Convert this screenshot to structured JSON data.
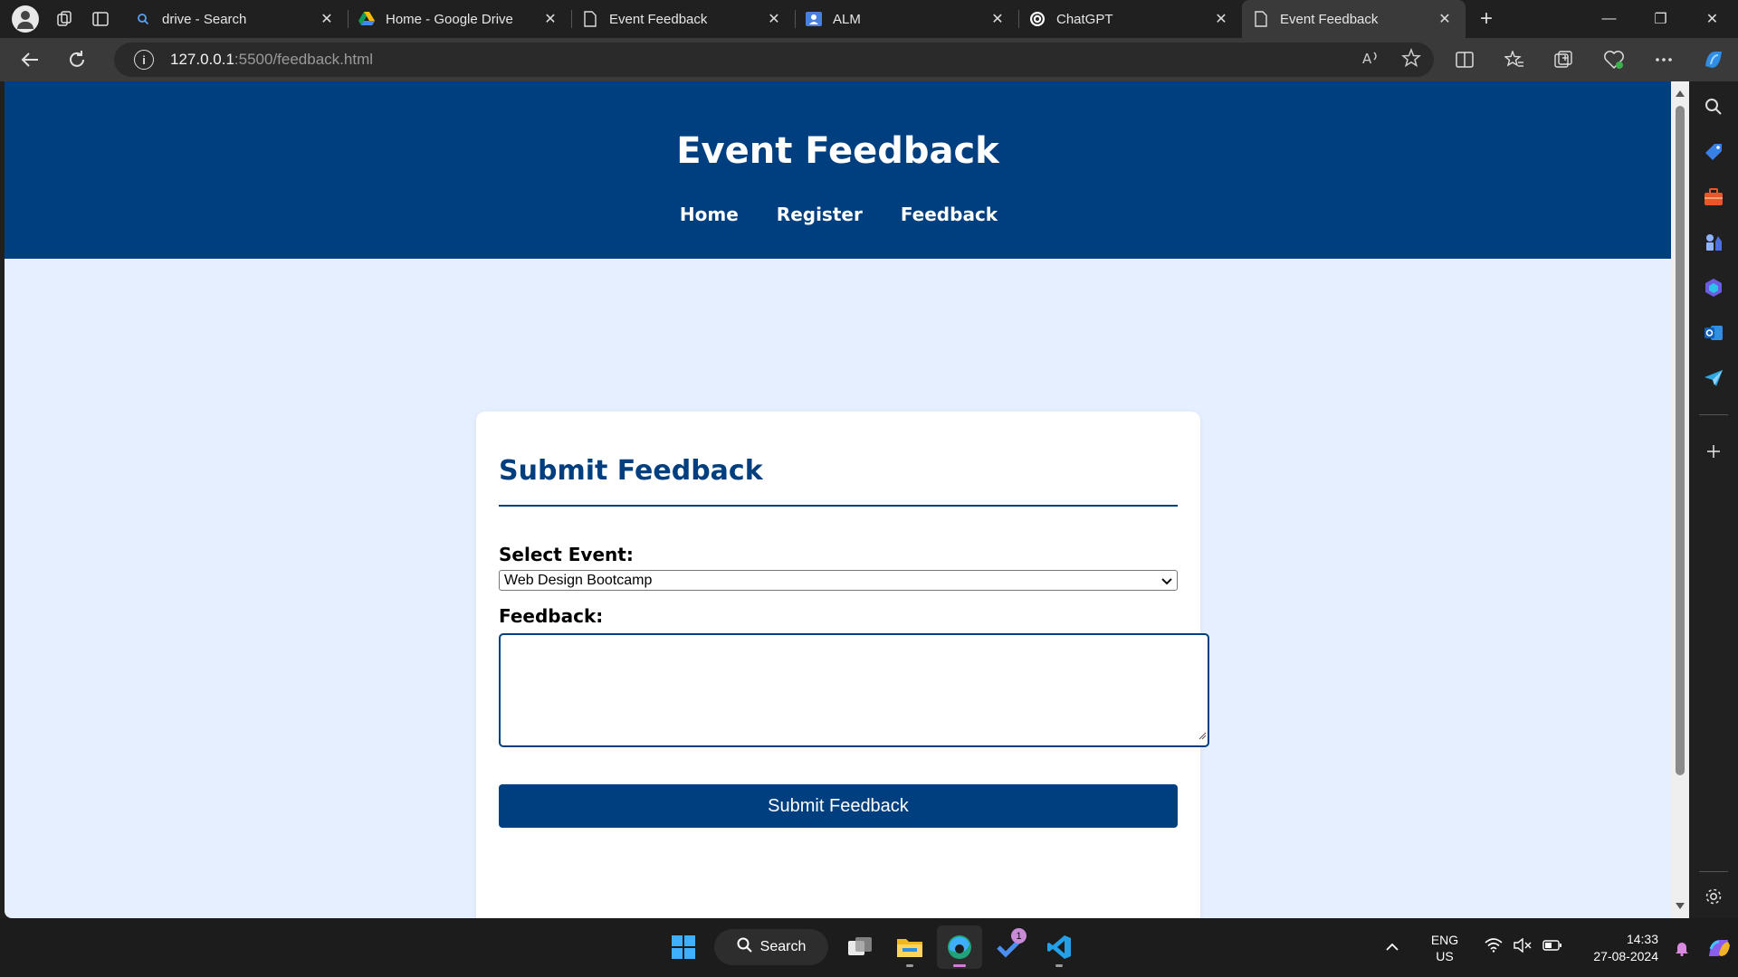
{
  "browser": {
    "tabs": [
      {
        "title": "drive - Search",
        "icon": "search-icon"
      },
      {
        "title": "Home - Google Drive",
        "icon": "google-drive-icon"
      },
      {
        "title": "Event Feedback",
        "icon": "page-icon"
      },
      {
        "title": "ALM",
        "icon": "contacts-icon"
      },
      {
        "title": "ChatGPT",
        "icon": "chatgpt-icon"
      },
      {
        "title": "Event Feedback",
        "icon": "page-icon",
        "active": true
      }
    ],
    "address": {
      "host": "127.0.0.1",
      "path": ":5500/feedback.html"
    }
  },
  "site": {
    "title": "Event Feedback",
    "nav": [
      "Home",
      "Register",
      "Feedback"
    ],
    "card": {
      "heading": "Submit Feedback",
      "select_label": "Select Event:",
      "selected_event": "Web Design Bootcamp",
      "feedback_label": "Feedback:",
      "feedback_value": "",
      "submit_label": "Submit Feedback"
    }
  },
  "taskbar": {
    "search_label": "Search",
    "language": [
      "ENG",
      "US"
    ],
    "time": "14:33",
    "date": "27-08-2024",
    "notification_badge": "1"
  },
  "colors": {
    "header_blue": "#003f7f",
    "page_bg": "#e6efff",
    "card_bg": "#ffffff"
  }
}
